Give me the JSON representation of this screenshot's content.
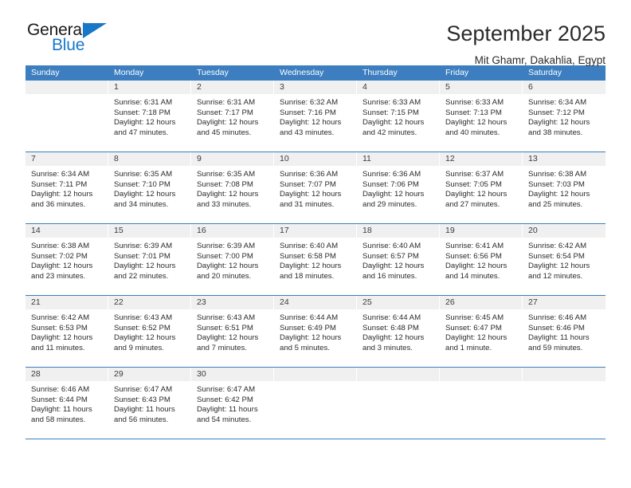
{
  "brand": {
    "name_top": "General",
    "name_bottom": "Blue",
    "accent_color": "#1878c8"
  },
  "header": {
    "title": "September 2025",
    "location": "Mit Ghamr, Dakahlia, Egypt"
  },
  "calendar": {
    "header_color": "#3c7ebf",
    "weekday_headers": [
      "Sunday",
      "Monday",
      "Tuesday",
      "Wednesday",
      "Thursday",
      "Friday",
      "Saturday"
    ],
    "weeks": [
      [
        {
          "day": "",
          "lines": []
        },
        {
          "day": "1",
          "lines": [
            "Sunrise: 6:31 AM",
            "Sunset: 7:18 PM",
            "Daylight: 12 hours",
            "and 47 minutes."
          ]
        },
        {
          "day": "2",
          "lines": [
            "Sunrise: 6:31 AM",
            "Sunset: 7:17 PM",
            "Daylight: 12 hours",
            "and 45 minutes."
          ]
        },
        {
          "day": "3",
          "lines": [
            "Sunrise: 6:32 AM",
            "Sunset: 7:16 PM",
            "Daylight: 12 hours",
            "and 43 minutes."
          ]
        },
        {
          "day": "4",
          "lines": [
            "Sunrise: 6:33 AM",
            "Sunset: 7:15 PM",
            "Daylight: 12 hours",
            "and 42 minutes."
          ]
        },
        {
          "day": "5",
          "lines": [
            "Sunrise: 6:33 AM",
            "Sunset: 7:13 PM",
            "Daylight: 12 hours",
            "and 40 minutes."
          ]
        },
        {
          "day": "6",
          "lines": [
            "Sunrise: 6:34 AM",
            "Sunset: 7:12 PM",
            "Daylight: 12 hours",
            "and 38 minutes."
          ]
        }
      ],
      [
        {
          "day": "7",
          "lines": [
            "Sunrise: 6:34 AM",
            "Sunset: 7:11 PM",
            "Daylight: 12 hours",
            "and 36 minutes."
          ]
        },
        {
          "day": "8",
          "lines": [
            "Sunrise: 6:35 AM",
            "Sunset: 7:10 PM",
            "Daylight: 12 hours",
            "and 34 minutes."
          ]
        },
        {
          "day": "9",
          "lines": [
            "Sunrise: 6:35 AM",
            "Sunset: 7:08 PM",
            "Daylight: 12 hours",
            "and 33 minutes."
          ]
        },
        {
          "day": "10",
          "lines": [
            "Sunrise: 6:36 AM",
            "Sunset: 7:07 PM",
            "Daylight: 12 hours",
            "and 31 minutes."
          ]
        },
        {
          "day": "11",
          "lines": [
            "Sunrise: 6:36 AM",
            "Sunset: 7:06 PM",
            "Daylight: 12 hours",
            "and 29 minutes."
          ]
        },
        {
          "day": "12",
          "lines": [
            "Sunrise: 6:37 AM",
            "Sunset: 7:05 PM",
            "Daylight: 12 hours",
            "and 27 minutes."
          ]
        },
        {
          "day": "13",
          "lines": [
            "Sunrise: 6:38 AM",
            "Sunset: 7:03 PM",
            "Daylight: 12 hours",
            "and 25 minutes."
          ]
        }
      ],
      [
        {
          "day": "14",
          "lines": [
            "Sunrise: 6:38 AM",
            "Sunset: 7:02 PM",
            "Daylight: 12 hours",
            "and 23 minutes."
          ]
        },
        {
          "day": "15",
          "lines": [
            "Sunrise: 6:39 AM",
            "Sunset: 7:01 PM",
            "Daylight: 12 hours",
            "and 22 minutes."
          ]
        },
        {
          "day": "16",
          "lines": [
            "Sunrise: 6:39 AM",
            "Sunset: 7:00 PM",
            "Daylight: 12 hours",
            "and 20 minutes."
          ]
        },
        {
          "day": "17",
          "lines": [
            "Sunrise: 6:40 AM",
            "Sunset: 6:58 PM",
            "Daylight: 12 hours",
            "and 18 minutes."
          ]
        },
        {
          "day": "18",
          "lines": [
            "Sunrise: 6:40 AM",
            "Sunset: 6:57 PM",
            "Daylight: 12 hours",
            "and 16 minutes."
          ]
        },
        {
          "day": "19",
          "lines": [
            "Sunrise: 6:41 AM",
            "Sunset: 6:56 PM",
            "Daylight: 12 hours",
            "and 14 minutes."
          ]
        },
        {
          "day": "20",
          "lines": [
            "Sunrise: 6:42 AM",
            "Sunset: 6:54 PM",
            "Daylight: 12 hours",
            "and 12 minutes."
          ]
        }
      ],
      [
        {
          "day": "21",
          "lines": [
            "Sunrise: 6:42 AM",
            "Sunset: 6:53 PM",
            "Daylight: 12 hours",
            "and 11 minutes."
          ]
        },
        {
          "day": "22",
          "lines": [
            "Sunrise: 6:43 AM",
            "Sunset: 6:52 PM",
            "Daylight: 12 hours",
            "and 9 minutes."
          ]
        },
        {
          "day": "23",
          "lines": [
            "Sunrise: 6:43 AM",
            "Sunset: 6:51 PM",
            "Daylight: 12 hours",
            "and 7 minutes."
          ]
        },
        {
          "day": "24",
          "lines": [
            "Sunrise: 6:44 AM",
            "Sunset: 6:49 PM",
            "Daylight: 12 hours",
            "and 5 minutes."
          ]
        },
        {
          "day": "25",
          "lines": [
            "Sunrise: 6:44 AM",
            "Sunset: 6:48 PM",
            "Daylight: 12 hours",
            "and 3 minutes."
          ]
        },
        {
          "day": "26",
          "lines": [
            "Sunrise: 6:45 AM",
            "Sunset: 6:47 PM",
            "Daylight: 12 hours",
            "and 1 minute."
          ]
        },
        {
          "day": "27",
          "lines": [
            "Sunrise: 6:46 AM",
            "Sunset: 6:46 PM",
            "Daylight: 11 hours",
            "and 59 minutes."
          ]
        }
      ],
      [
        {
          "day": "28",
          "lines": [
            "Sunrise: 6:46 AM",
            "Sunset: 6:44 PM",
            "Daylight: 11 hours",
            "and 58 minutes."
          ]
        },
        {
          "day": "29",
          "lines": [
            "Sunrise: 6:47 AM",
            "Sunset: 6:43 PM",
            "Daylight: 11 hours",
            "and 56 minutes."
          ]
        },
        {
          "day": "30",
          "lines": [
            "Sunrise: 6:47 AM",
            "Sunset: 6:42 PM",
            "Daylight: 11 hours",
            "and 54 minutes."
          ]
        },
        {
          "day": "",
          "lines": []
        },
        {
          "day": "",
          "lines": []
        },
        {
          "day": "",
          "lines": []
        },
        {
          "day": "",
          "lines": []
        }
      ]
    ]
  }
}
